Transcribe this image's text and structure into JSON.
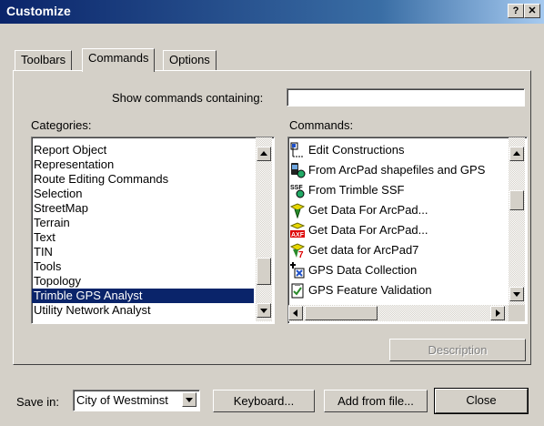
{
  "window": {
    "title": "Customize",
    "help_glyph": "?",
    "close_glyph": "✕"
  },
  "tabs": [
    {
      "label": "Toolbars"
    },
    {
      "label": "Commands",
      "active": true
    },
    {
      "label": "Options"
    }
  ],
  "search": {
    "label": "Show commands containing:",
    "value": ""
  },
  "categories": {
    "label": "Categories:",
    "items": [
      "Report Object",
      "Representation",
      "Route Editing Commands",
      "Selection",
      "StreetMap",
      "Terrain",
      "Text",
      "TIN",
      "Tools",
      "Topology",
      "Trimble GPS Analyst",
      "Utility Network Analyst"
    ],
    "selected": "Trimble GPS Analyst"
  },
  "commands": {
    "label": "Commands:",
    "items": [
      {
        "label": "Edit Constructions",
        "icon": "edit-constructions-icon"
      },
      {
        "label": "From ArcPad shapefiles and GPS",
        "icon": "arcpad-shapefile-icon"
      },
      {
        "label": "From Trimble SSF",
        "icon": "trimble-ssf-icon"
      },
      {
        "label": "Get Data For ArcPad...",
        "icon": "arcpad-get-data-icon"
      },
      {
        "label": "Get Data For ArcPad...",
        "icon": "arcpad-axf-icon"
      },
      {
        "label": "Get data for ArcPad7",
        "icon": "arcpad7-icon"
      },
      {
        "label": "GPS Data Collection",
        "icon": "gps-data-collection-icon"
      },
      {
        "label": "GPS Feature Validation",
        "icon": "gps-feature-validation-icon"
      }
    ],
    "icon_text": {
      "ssf": "SSF",
      "axf": "AXF",
      "seven": "7"
    }
  },
  "description_button": "Description",
  "footer": {
    "save_in_label": "Save in:",
    "save_in_value": "City of Westminst",
    "keyboard_button": "Keyboard...",
    "add_from_file_button": "Add from file...",
    "close_button": "Close"
  },
  "colors": {
    "selection": "#0a246a",
    "face": "#d4d0c8",
    "titlebar": "#0a246a"
  }
}
